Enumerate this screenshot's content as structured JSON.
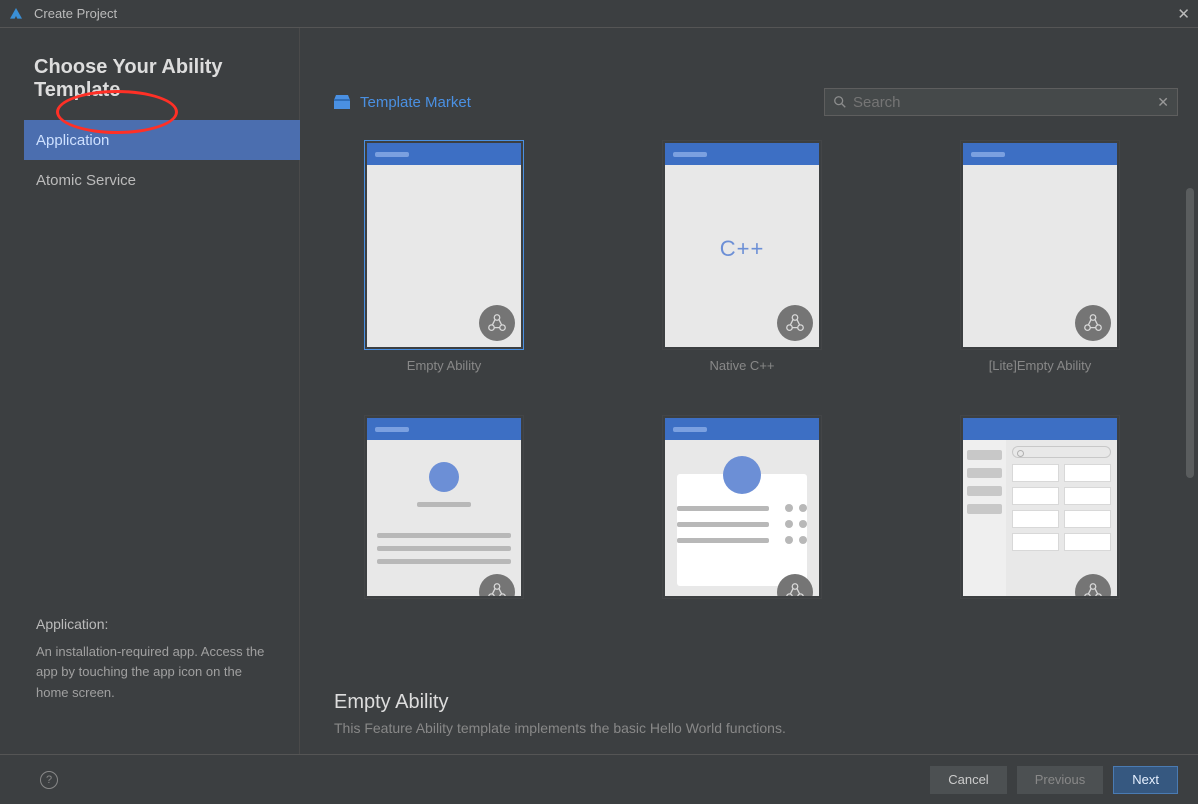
{
  "window": {
    "title": "Create Project"
  },
  "heading": "Choose Your Ability Template",
  "sidebar": {
    "tabs": [
      {
        "label": "Application",
        "active": true
      },
      {
        "label": "Atomic Service",
        "active": false
      }
    ],
    "info_title": "Application:",
    "info_desc": "An installation-required app. Access the app by touching the app icon on the home screen."
  },
  "main": {
    "market_label": "Template Market",
    "search_placeholder": "Search",
    "templates": [
      {
        "label": "Empty Ability",
        "selected": true,
        "kind": "empty"
      },
      {
        "label": "Native C++",
        "selected": false,
        "kind": "cpp"
      },
      {
        "label": "[Lite]Empty Ability",
        "selected": false,
        "kind": "empty"
      },
      {
        "label": "",
        "selected": false,
        "kind": "list"
      },
      {
        "label": "",
        "selected": false,
        "kind": "panel"
      },
      {
        "label": "",
        "selected": false,
        "kind": "category"
      }
    ],
    "selected_title": "Empty Ability",
    "selected_desc": "This Feature Ability template implements the basic Hello World functions."
  },
  "footer": {
    "cancel": "Cancel",
    "previous": "Previous",
    "next": "Next"
  }
}
